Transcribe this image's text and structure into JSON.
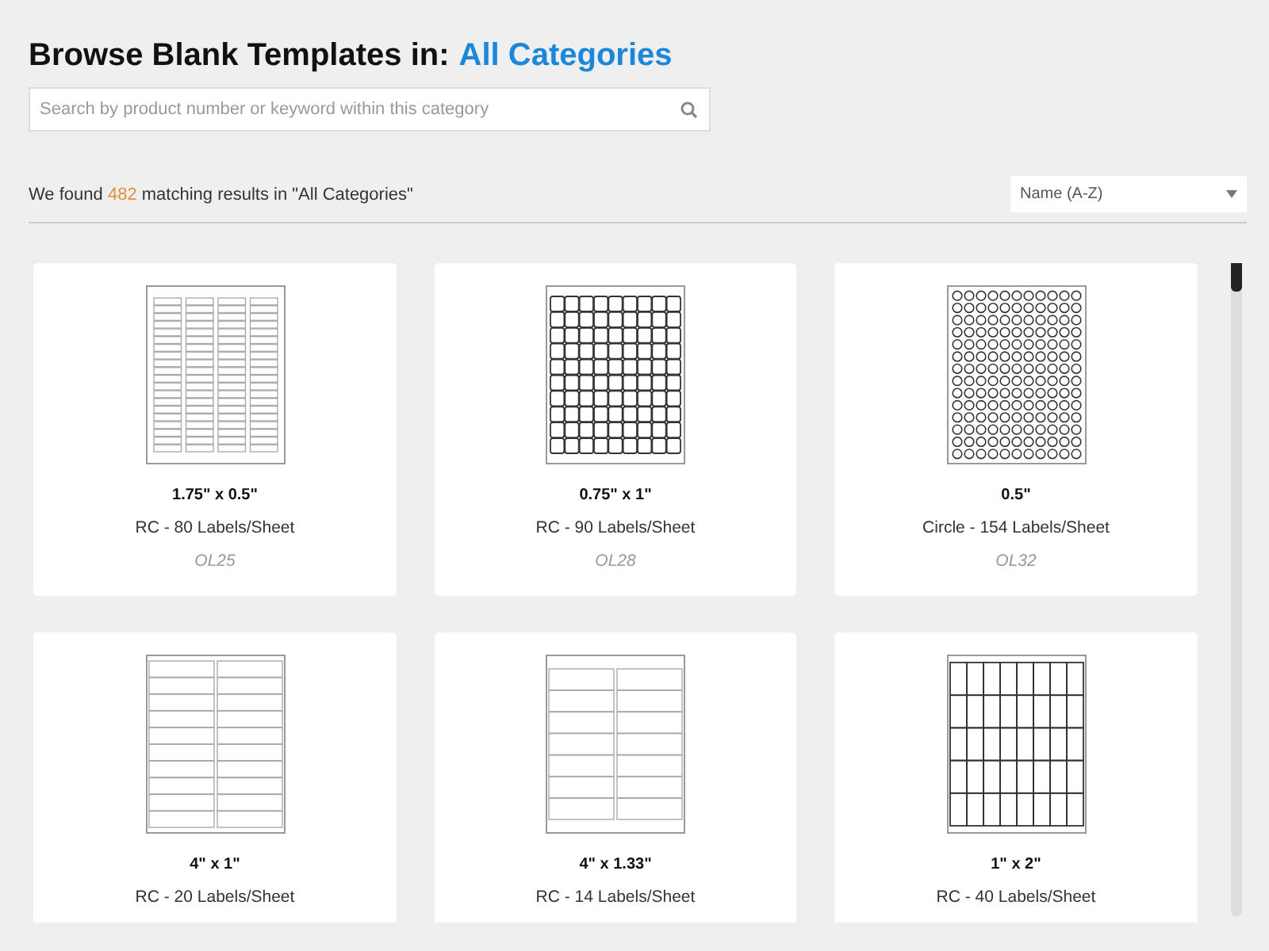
{
  "header": {
    "title": "Browse Blank Templates in:",
    "category": "All Categories"
  },
  "search": {
    "placeholder": "Search by product number or keyword within this category"
  },
  "results": {
    "prefix": "We found",
    "count": "482",
    "suffix": "matching results in \"All Categories\""
  },
  "sort": {
    "value": "Name (A-Z)"
  },
  "templates": [
    {
      "kind": "narrow-rect",
      "size": "1.75\" x 0.5\"",
      "description": "RC - 80 Labels/Sheet",
      "code": "OL25"
    },
    {
      "kind": "rounded-grid",
      "size": "0.75\" x 1\"",
      "description": "RC - 90 Labels/Sheet",
      "code": "OL28"
    },
    {
      "kind": "circle-grid",
      "size": "0.5\"",
      "description": "Circle - 154 Labels/Sheet",
      "code": "OL32"
    },
    {
      "kind": "two-column",
      "size": "4\" x 1\"",
      "description": "RC - 20 Labels/Sheet"
    },
    {
      "kind": "two-column-wide",
      "size": "4\" x 1.33\"",
      "description": "RC - 14 Labels/Sheet"
    },
    {
      "kind": "tall-grid",
      "size": "1\" x 2\"",
      "description": "RC - 40 Labels/Sheet"
    }
  ]
}
